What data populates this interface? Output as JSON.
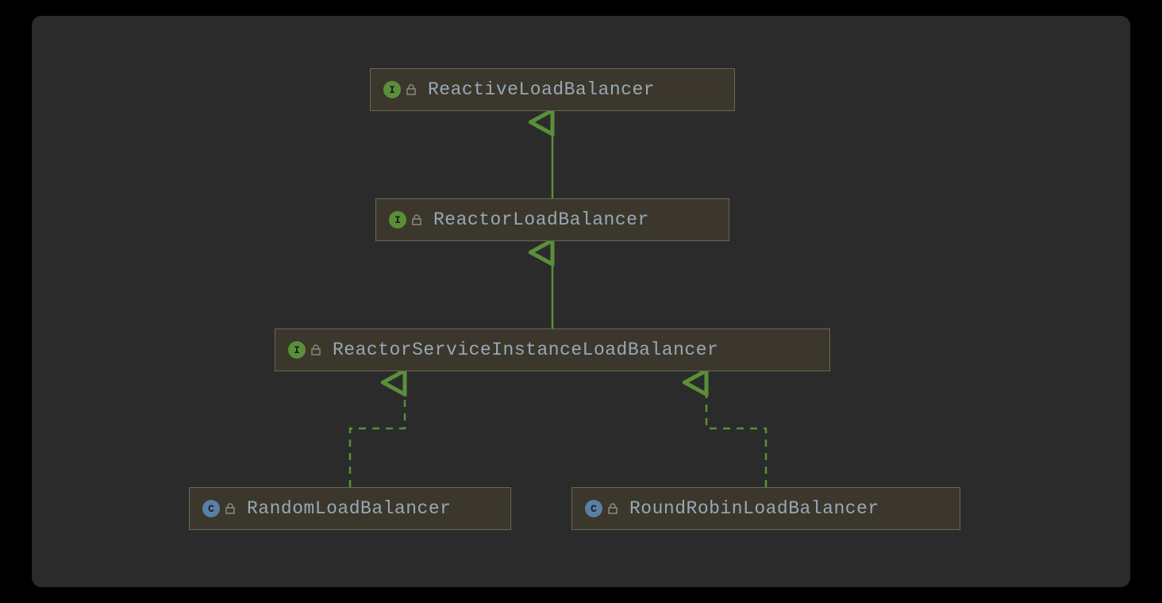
{
  "diagram": {
    "nodes": [
      {
        "id": "n0",
        "kind": "interface",
        "badge": "I",
        "label": "ReactiveLoadBalancer"
      },
      {
        "id": "n1",
        "kind": "interface",
        "badge": "I",
        "label": "ReactorLoadBalancer"
      },
      {
        "id": "n2",
        "kind": "interface",
        "badge": "I",
        "label": "ReactorServiceInstanceLoadBalancer"
      },
      {
        "id": "n3",
        "kind": "class",
        "badge": "C",
        "label": "RandomLoadBalancer"
      },
      {
        "id": "n4",
        "kind": "class",
        "badge": "C",
        "label": "RoundRobinLoadBalancer"
      }
    ],
    "edges": [
      {
        "from": "n1",
        "to": "n0",
        "style": "solid"
      },
      {
        "from": "n2",
        "to": "n1",
        "style": "solid"
      },
      {
        "from": "n3",
        "to": "n2",
        "style": "dashed"
      },
      {
        "from": "n4",
        "to": "n2",
        "style": "dashed"
      }
    ],
    "colors": {
      "panel_bg": "#2b2b2b",
      "node_bg": "#3b372c",
      "node_border": "#6b6755",
      "text": "#99a8b5",
      "line": "#5a8f3a",
      "interface_badge": "#5a8f3a",
      "class_badge": "#5b7fa6"
    }
  }
}
